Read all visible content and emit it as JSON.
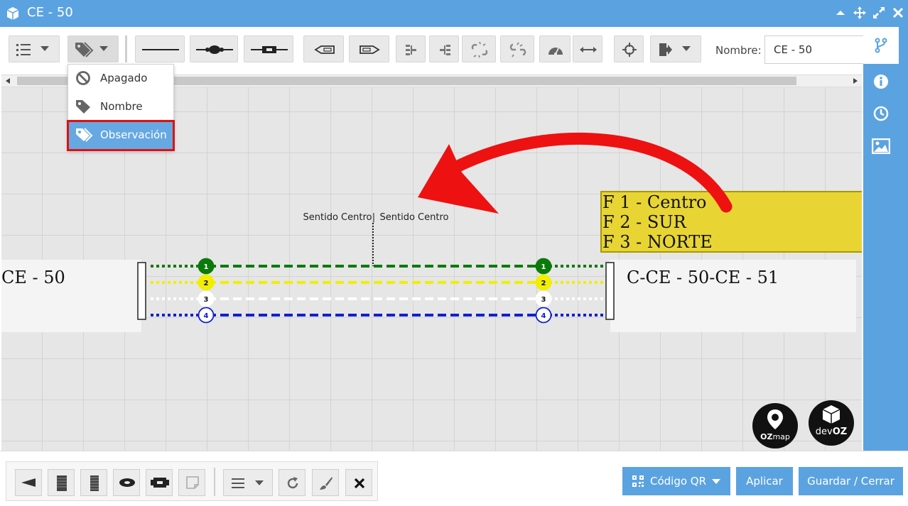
{
  "window": {
    "title": "CE - 50"
  },
  "toolbar": {
    "nombre_label": "Nombre:",
    "nombre_value": "CE - 50"
  },
  "label_menu": {
    "items": [
      {
        "label": "Apagado",
        "icon": "ban-icon"
      },
      {
        "label": "Nombre",
        "icon": "tag-icon"
      },
      {
        "label": "Observación",
        "icon": "tags-icon",
        "selected": true
      }
    ]
  },
  "diagram": {
    "left_cable_label": "CE - 50",
    "right_cable_label": "C-CE - 50-CE - 51",
    "direction_left": "Sentido Centro",
    "direction_separator": "|",
    "direction_right": "Sentido Centro",
    "observation_lines": [
      "F 1 - Centro",
      "F 2 - SUR",
      "F 3 - NORTE"
    ],
    "fibers": [
      {
        "number": "1",
        "color": "#0a7a0a"
      },
      {
        "number": "2",
        "color": "#f2ee00"
      },
      {
        "number": "3",
        "color": "#ffffff"
      },
      {
        "number": "4",
        "color": "#1020d0"
      }
    ]
  },
  "logos": {
    "ozmap_bold": "OZ",
    "ozmap_rest": "map",
    "devoz_prefix": "dev",
    "devoz_bold": "OZ"
  },
  "footer": {
    "qr_label": "Código QR",
    "apply_label": "Aplicar",
    "save_close_label": "Guardar / Cerrar"
  },
  "colors": {
    "accent": "#5ba3e0",
    "highlight": "#e01010",
    "annotation_arrow": "#ee1111",
    "note_bg": "#e8d534"
  }
}
